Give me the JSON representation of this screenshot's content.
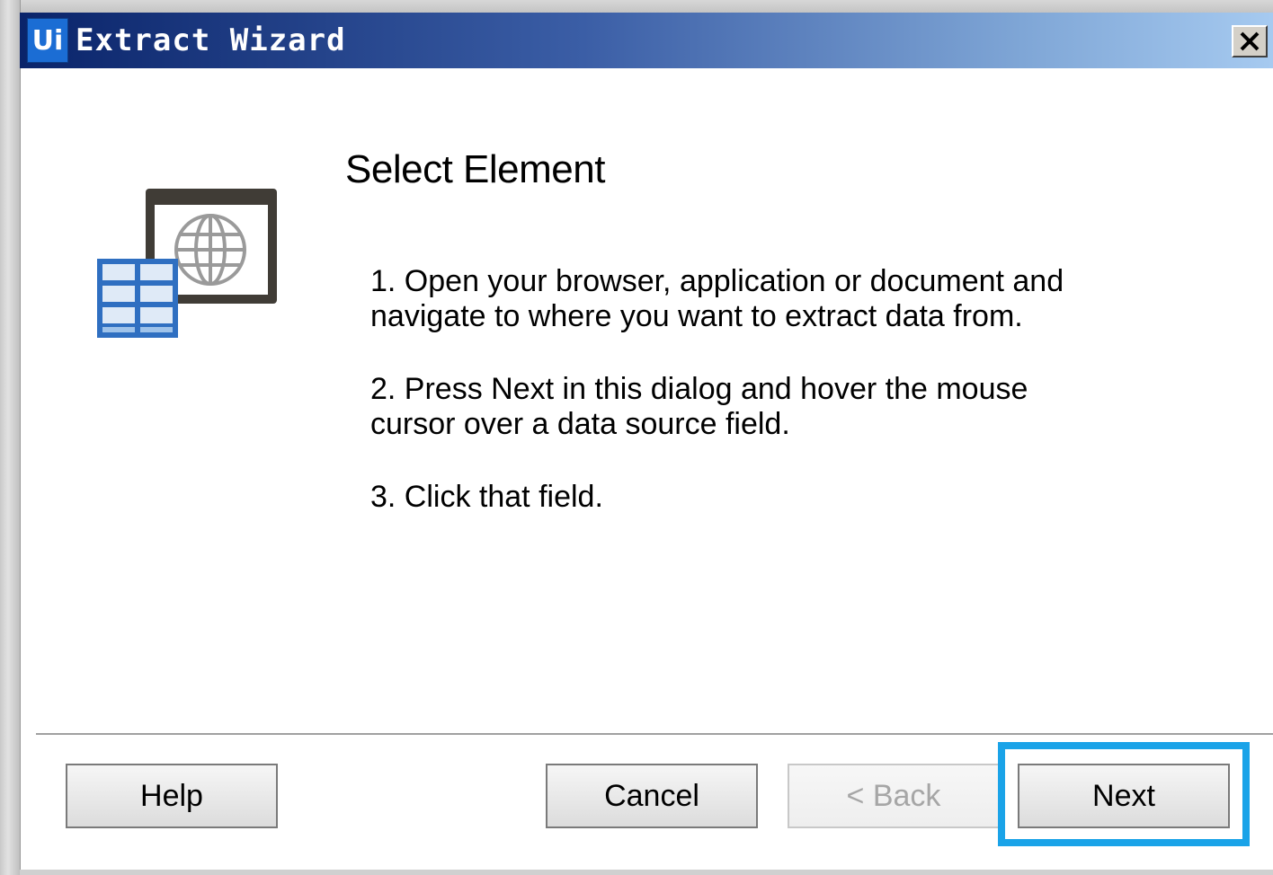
{
  "window": {
    "app_logo_text": "Ui",
    "title": "Extract Wizard",
    "close_glyph": "×"
  },
  "page": {
    "heading": "Select Element",
    "icon": "table-browser-globe-icon",
    "steps": [
      "1. Open your browser, application or document and\nnavigate to where you want to extract data from.",
      "2. Press Next in this dialog and hover the mouse\ncursor over a data source field.",
      "3. Click that field."
    ]
  },
  "buttons": {
    "help": "Help",
    "cancel": "Cancel",
    "back": "< Back",
    "next": "Next"
  },
  "colors": {
    "highlight": "#1aa3e8",
    "titlebar_start": "#0a246a",
    "titlebar_end": "#a6caf0"
  }
}
